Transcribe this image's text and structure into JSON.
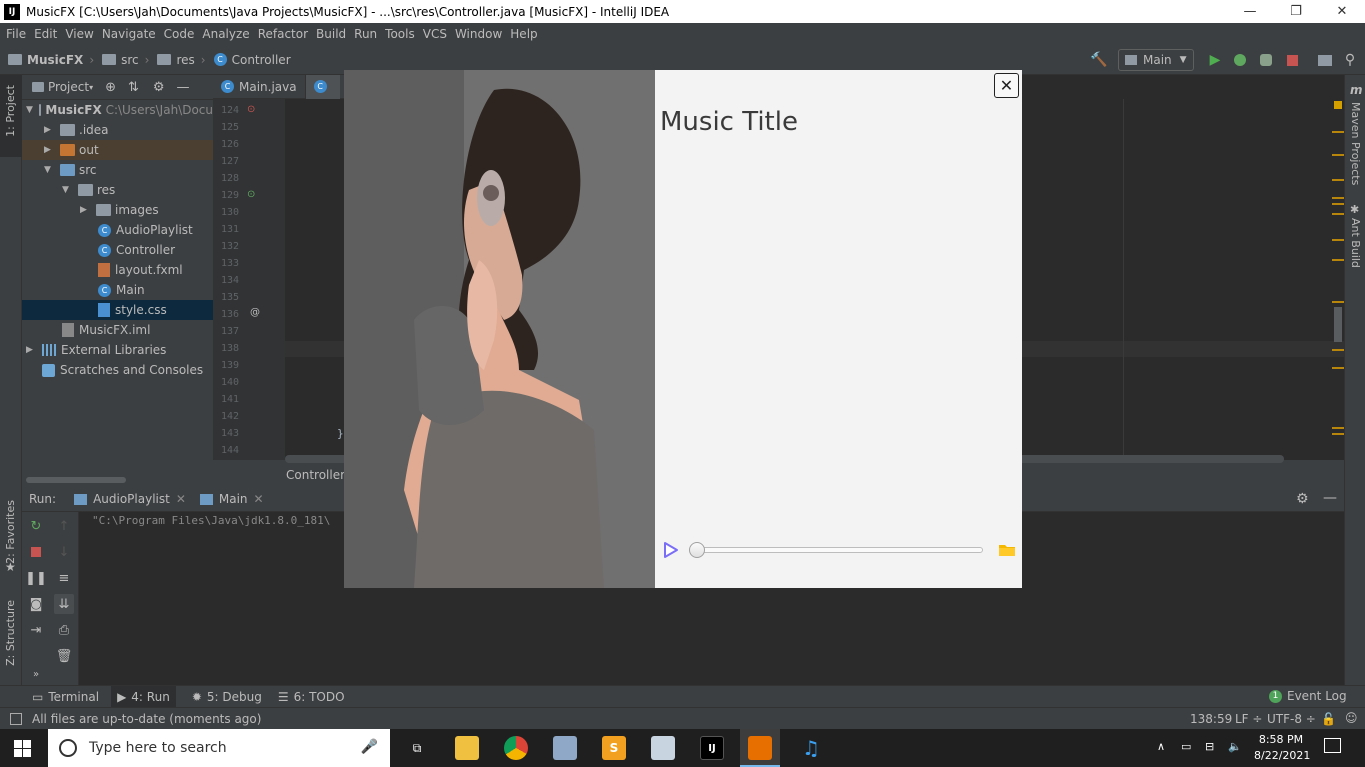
{
  "window": {
    "title": "MusicFX [C:\\Users\\Jah\\Documents\\Java Projects\\MusicFX] - ...\\src\\res\\Controller.java [MusicFX] - IntelliJ IDEA",
    "logo": "IJ",
    "minimize": "—",
    "maximize": "❐",
    "close": "✕"
  },
  "menu": [
    "File",
    "Edit",
    "View",
    "Navigate",
    "Code",
    "Analyze",
    "Refactor",
    "Build",
    "Run",
    "Tools",
    "VCS",
    "Window",
    "Help"
  ],
  "nav": {
    "crumbs": [
      "MusicFX",
      "src",
      "res",
      "Controller"
    ],
    "run_config": "Main"
  },
  "left_strip": {
    "project_tab": "1: Project",
    "favorites_tab": "2: Favorites",
    "structure_tab": "Z: Structure"
  },
  "right_strip": {
    "maven_tab": "Maven Projects",
    "ant_tab": "Ant Build",
    "maven_icon": "m"
  },
  "project_panel": {
    "header": "Project",
    "tree": [
      {
        "label": "MusicFX",
        "extra": "C:\\Users\\Jah\\Docu"
      },
      {
        "label": ".idea"
      },
      {
        "label": "out"
      },
      {
        "label": "src"
      },
      {
        "label": "res"
      },
      {
        "label": "images"
      },
      {
        "label": "AudioPlaylist"
      },
      {
        "label": "Controller"
      },
      {
        "label": "layout.fxml"
      },
      {
        "label": "Main"
      },
      {
        "label": "style.css"
      },
      {
        "label": "MusicFX.iml"
      },
      {
        "label": "External Libraries"
      },
      {
        "label": "Scratches and Consoles"
      }
    ]
  },
  "editor": {
    "tabs": [
      "Main.java"
    ],
    "line_numbers": [
      "124",
      "125",
      "126",
      "127",
      "128",
      "129",
      "130",
      "131",
      "132",
      "133",
      "134",
      "135",
      "136",
      "137",
      "138",
      "139",
      "140",
      "141",
      "142",
      "143",
      "144"
    ],
    "breadcrumb": "Controller",
    "code_fragment": "}",
    "gutter_mark": "@"
  },
  "run_panel": {
    "label": "Run:",
    "tabs": [
      "AudioPlaylist",
      "Main"
    ],
    "console_line": "\"C:\\Program Files\\Java\\jdk1.8.0_181\\"
  },
  "bottom_tools": [
    {
      "label": "Terminal"
    },
    {
      "label": "4: Run"
    },
    {
      "label": "5: Debug"
    },
    {
      "label": "6: TODO"
    }
  ],
  "event_log": {
    "count": "1",
    "label": "Event Log"
  },
  "status": {
    "message": "All files are up-to-date (moments ago)",
    "position": "138:59",
    "line_sep": "LF ÷",
    "encoding": "UTF-8 ÷"
  },
  "taskbar": {
    "search_placeholder": "Type here to search",
    "time": "8:58 PM",
    "date": "8/22/2021"
  },
  "music_player": {
    "title": "Music Title",
    "close_label": "✕",
    "progress": 0,
    "colors": {
      "play": "#7b6ef6",
      "folder": "#f5b800"
    }
  }
}
